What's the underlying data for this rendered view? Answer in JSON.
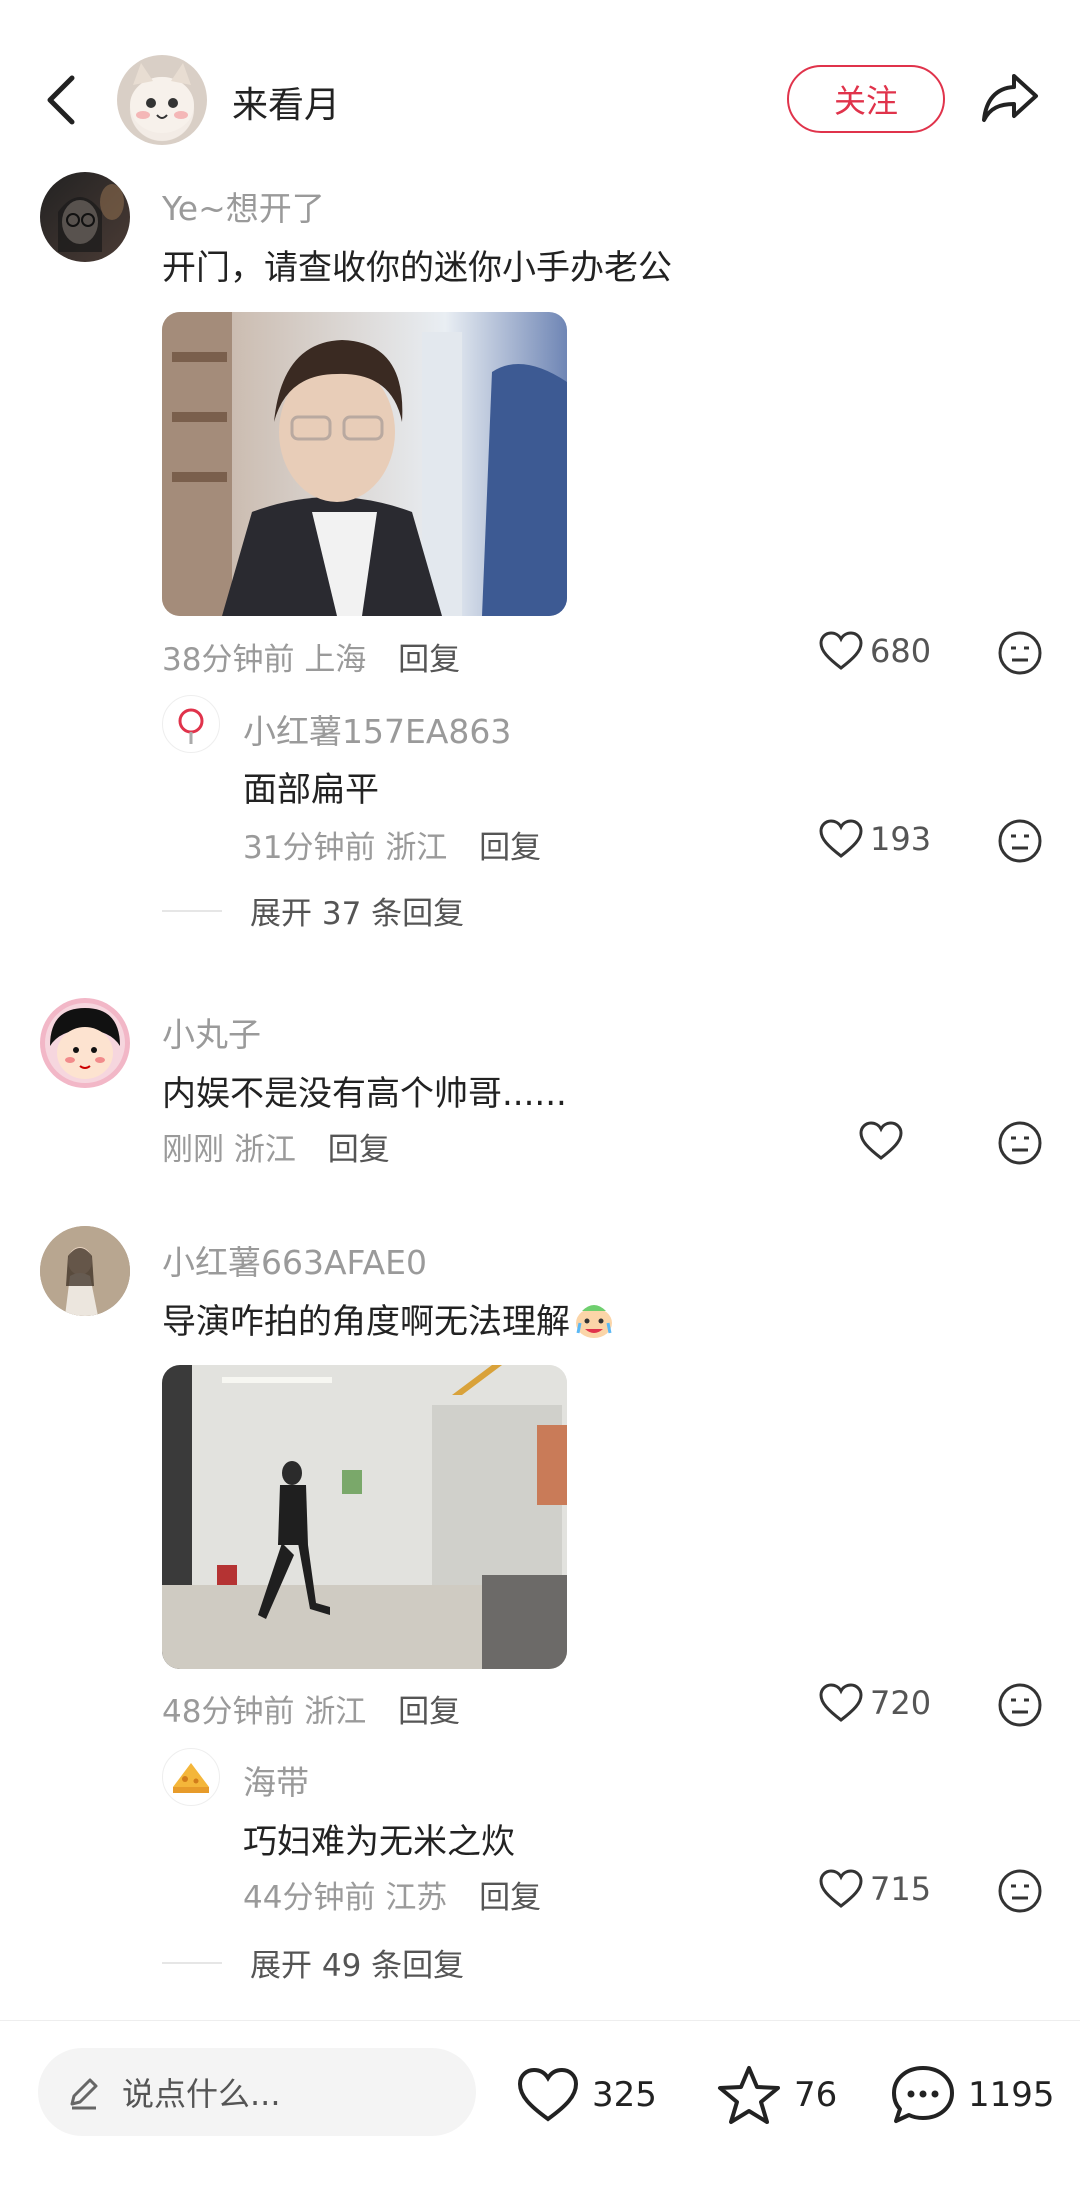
{
  "header": {
    "author": "来看月",
    "follow_label": "关注"
  },
  "comments": [
    {
      "user": "Ye~想开了",
      "text": "开门，请查收你的迷你小手办老公",
      "time": "38分钟前",
      "location": "上海",
      "reply_label": "回复",
      "likes": "680",
      "replies": [
        {
          "user": "小红薯157EA863",
          "text": "面部扁平",
          "time": "31分钟前",
          "location": "浙江",
          "reply_label": "回复",
          "likes": "193"
        }
      ],
      "expand": "展开 37 条回复"
    },
    {
      "user": "小丸子",
      "text": "内娱不是没有高个帅哥......",
      "time": "刚刚",
      "location": "浙江",
      "reply_label": "回复",
      "likes": ""
    },
    {
      "user": "小红薯663AFAE0",
      "text": "导演咋拍的角度啊无法理解",
      "time": "48分钟前",
      "location": "浙江",
      "reply_label": "回复",
      "likes": "720",
      "replies": [
        {
          "user": "海带",
          "text": "巧妇难为无米之炊",
          "time": "44分钟前",
          "location": "江苏",
          "reply_label": "回复",
          "likes": "715"
        }
      ],
      "expand": "展开 49 条回复"
    }
  ],
  "bottom_bar": {
    "input_placeholder": "说点什么...",
    "likes": "325",
    "favorites": "76",
    "comments": "1195"
  },
  "colors": {
    "accent": "#e0334b",
    "meta_gray": "#9a9a9a"
  }
}
